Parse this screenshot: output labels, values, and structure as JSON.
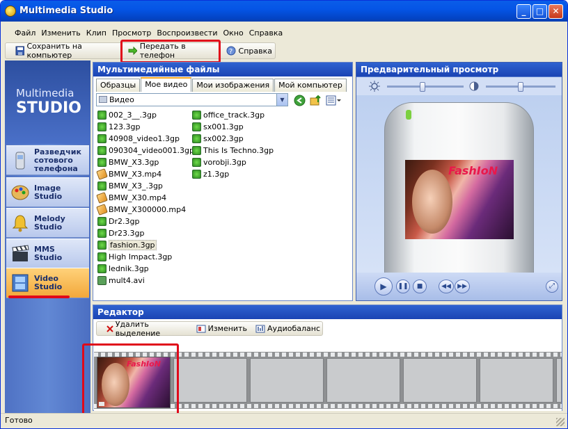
{
  "window": {
    "title": "Multimedia Studio"
  },
  "menu": [
    "Файл",
    "Изменить",
    "Клип",
    "Просмотр",
    "Воспроизвести",
    "Окно",
    "Справка"
  ],
  "toolbar": {
    "save_label": "Сохранить на компьютер",
    "send_label": "Передать в телефон",
    "help_label": "Справка"
  },
  "sidebar": {
    "logo_line1": "Multimedia",
    "logo_line2": "STUDIO",
    "items": [
      {
        "label": "Разведчик сотового телефона"
      },
      {
        "label": "Image Studio"
      },
      {
        "label": "Melody Studio"
      },
      {
        "label": "MMS Studio"
      },
      {
        "label": "Video Studio",
        "active": true
      }
    ]
  },
  "media": {
    "title": "Мультимедийные файлы",
    "tabs": [
      "Образцы",
      "Мое видео",
      "Мои изображения",
      "Мой компьютер"
    ],
    "active_tab": "Мое видео",
    "path": "Видео",
    "files_col1": [
      "002_3__.3gp",
      "123.3gp",
      "40908_video1.3gp",
      "090304_video001.3gp",
      "BMW_X3.3gp",
      "BMW_X3.mp4",
      "BMW_X3_.3gp",
      "BMW_X30.mp4",
      "BMW_X300000.mp4",
      "Dr2.3gp",
      "Dr23.3gp",
      "fashion.3gp",
      "High Impact.3gp",
      "lednik.3gp",
      "mult4.avi"
    ],
    "files_col2": [
      "office_track.3gp",
      "sx001.3gp",
      "sx002.3gp",
      "This Is Techno.3gp",
      "vorobji.3gp",
      "z1.3gp"
    ],
    "selected": "fashion.3gp"
  },
  "preview": {
    "title": "Предварительный просмотр",
    "brightness_level": 0.5,
    "contrast_level": 0.5,
    "clip_caption": "FashIoN"
  },
  "editor": {
    "title": "Редактор",
    "delete_label": "Удалить выделение",
    "edit_label": "Изменить",
    "audio_label": "Аудиобаланс",
    "clip_caption": "FashIoN"
  },
  "status": {
    "text": "Готово"
  },
  "colors": {
    "highlight": "#e0091a",
    "titlebar": "#0555e6",
    "panel_header": "#1b44b4"
  }
}
